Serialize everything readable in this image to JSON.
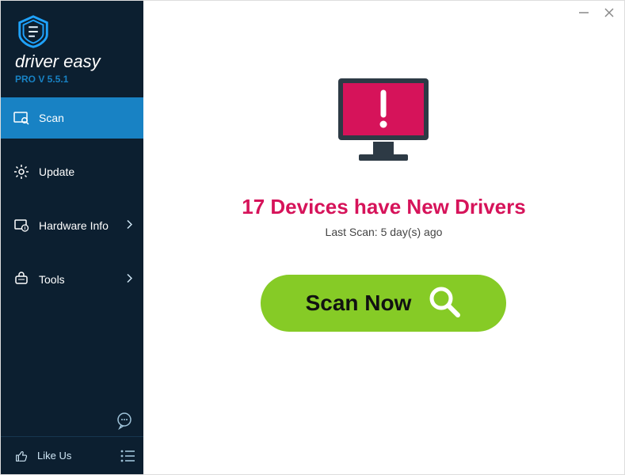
{
  "brand": {
    "name": "driver easy",
    "version": "PRO V 5.5.1"
  },
  "sidebar": {
    "items": [
      {
        "label": "Scan"
      },
      {
        "label": "Update"
      },
      {
        "label": "Hardware Info"
      },
      {
        "label": "Tools"
      }
    ],
    "like_label": "Like Us"
  },
  "main": {
    "headline": "17 Devices have New Drivers",
    "subline": "Last Scan: 5 day(s) ago",
    "scan_label": "Scan Now"
  },
  "colors": {
    "accent": "#1882c4",
    "alert": "#d6135a",
    "action": "#86cb26"
  }
}
